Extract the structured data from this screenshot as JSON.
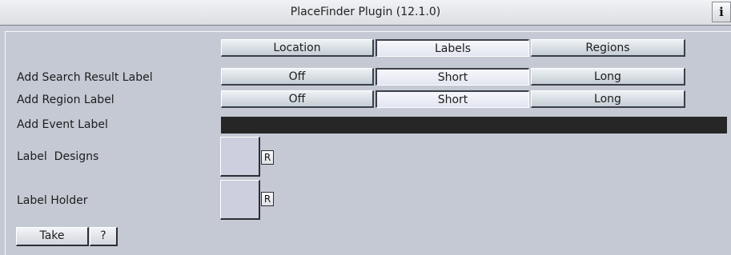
{
  "window": {
    "title": "PlaceFinder Plugin (12.1.0)",
    "info_label": "i"
  },
  "tabs": [
    {
      "label": "Location",
      "selected": false
    },
    {
      "label": "Labels",
      "selected": true
    },
    {
      "label": "Regions",
      "selected": false
    }
  ],
  "rows": {
    "search_result": {
      "label": "Add Search Result Label",
      "options": [
        "Off",
        "Short",
        "Long"
      ],
      "selected": "Short"
    },
    "region": {
      "label": "Add Region Label",
      "options": [
        "Off",
        "Short",
        "Long"
      ],
      "selected": "Short"
    },
    "event": {
      "label": "Add Event Label",
      "value": ""
    },
    "designs": {
      "label": "Label  Designs",
      "reset_label": "R"
    },
    "holder": {
      "label": "Label Holder",
      "reset_label": "R"
    }
  },
  "footer": {
    "take_label": "Take",
    "help_label": "?"
  },
  "colors": {
    "background": "#c5c9d3",
    "field_dark": "#262626",
    "drop_slot": "#cdcfde"
  }
}
